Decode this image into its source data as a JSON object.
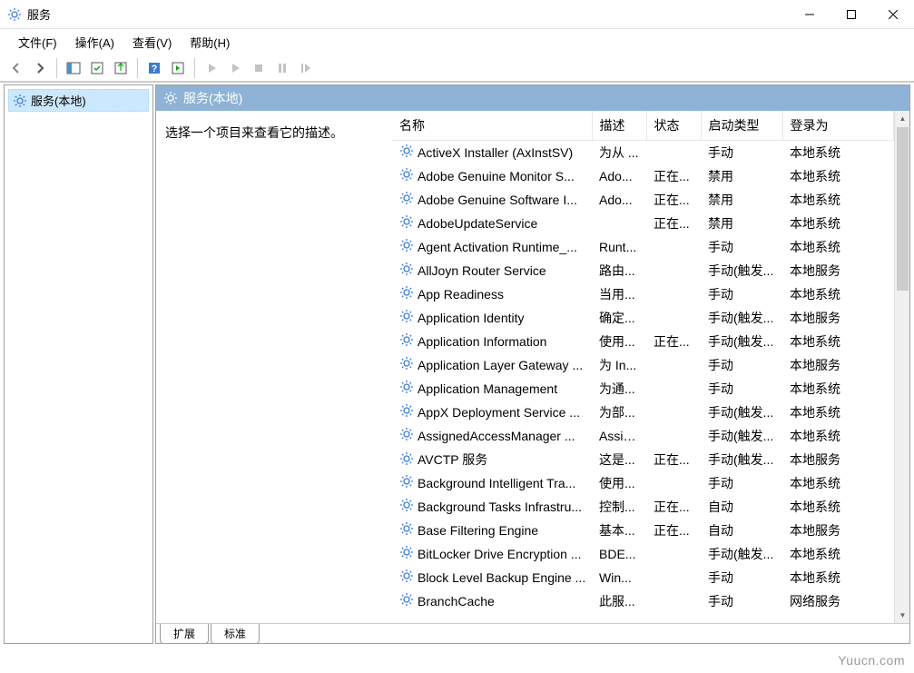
{
  "window": {
    "title": "服务"
  },
  "menu": {
    "file": "文件(F)",
    "action": "操作(A)",
    "view": "查看(V)",
    "help": "帮助(H)"
  },
  "tree": {
    "root": "服务(本地)"
  },
  "pane": {
    "title": "服务(本地)",
    "hint": "选择一个项目来查看它的描述。"
  },
  "columns": {
    "name": "名称",
    "desc": "描述",
    "status": "状态",
    "startup": "启动类型",
    "logon": "登录为"
  },
  "tabs": {
    "extended": "扩展",
    "standard": "标准"
  },
  "watermark": "Yuucn.com",
  "services": [
    {
      "name": "ActiveX Installer (AxInstSV)",
      "desc": "为从 ...",
      "status": "",
      "startup": "手动",
      "logon": "本地系统"
    },
    {
      "name": "Adobe Genuine Monitor S...",
      "desc": "Ado...",
      "status": "正在...",
      "startup": "禁用",
      "logon": "本地系统"
    },
    {
      "name": "Adobe Genuine Software I...",
      "desc": "Ado...",
      "status": "正在...",
      "startup": "禁用",
      "logon": "本地系统"
    },
    {
      "name": "AdobeUpdateService",
      "desc": "",
      "status": "正在...",
      "startup": "禁用",
      "logon": "本地系统"
    },
    {
      "name": "Agent Activation Runtime_...",
      "desc": "Runt...",
      "status": "",
      "startup": "手动",
      "logon": "本地系统"
    },
    {
      "name": "AllJoyn Router Service",
      "desc": "路由...",
      "status": "",
      "startup": "手动(触发...",
      "logon": "本地服务"
    },
    {
      "name": "App Readiness",
      "desc": "当用...",
      "status": "",
      "startup": "手动",
      "logon": "本地系统"
    },
    {
      "name": "Application Identity",
      "desc": "确定...",
      "status": "",
      "startup": "手动(触发...",
      "logon": "本地服务"
    },
    {
      "name": "Application Information",
      "desc": "使用...",
      "status": "正在...",
      "startup": "手动(触发...",
      "logon": "本地系统"
    },
    {
      "name": "Application Layer Gateway ...",
      "desc": "为 In...",
      "status": "",
      "startup": "手动",
      "logon": "本地服务"
    },
    {
      "name": "Application Management",
      "desc": "为通...",
      "status": "",
      "startup": "手动",
      "logon": "本地系统"
    },
    {
      "name": "AppX Deployment Service ...",
      "desc": "为部...",
      "status": "",
      "startup": "手动(触发...",
      "logon": "本地系统"
    },
    {
      "name": "AssignedAccessManager ...",
      "desc": "Assig...",
      "status": "",
      "startup": "手动(触发...",
      "logon": "本地系统"
    },
    {
      "name": "AVCTP 服务",
      "desc": "这是...",
      "status": "正在...",
      "startup": "手动(触发...",
      "logon": "本地服务"
    },
    {
      "name": "Background Intelligent Tra...",
      "desc": "使用...",
      "status": "",
      "startup": "手动",
      "logon": "本地系统"
    },
    {
      "name": "Background Tasks Infrastru...",
      "desc": "控制...",
      "status": "正在...",
      "startup": "自动",
      "logon": "本地系统"
    },
    {
      "name": "Base Filtering Engine",
      "desc": "基本...",
      "status": "正在...",
      "startup": "自动",
      "logon": "本地服务"
    },
    {
      "name": "BitLocker Drive Encryption ...",
      "desc": "BDE...",
      "status": "",
      "startup": "手动(触发...",
      "logon": "本地系统"
    },
    {
      "name": "Block Level Backup Engine ...",
      "desc": "Win...",
      "status": "",
      "startup": "手动",
      "logon": "本地系统"
    },
    {
      "name": "BranchCache",
      "desc": "此服...",
      "status": "",
      "startup": "手动",
      "logon": "网络服务"
    }
  ]
}
